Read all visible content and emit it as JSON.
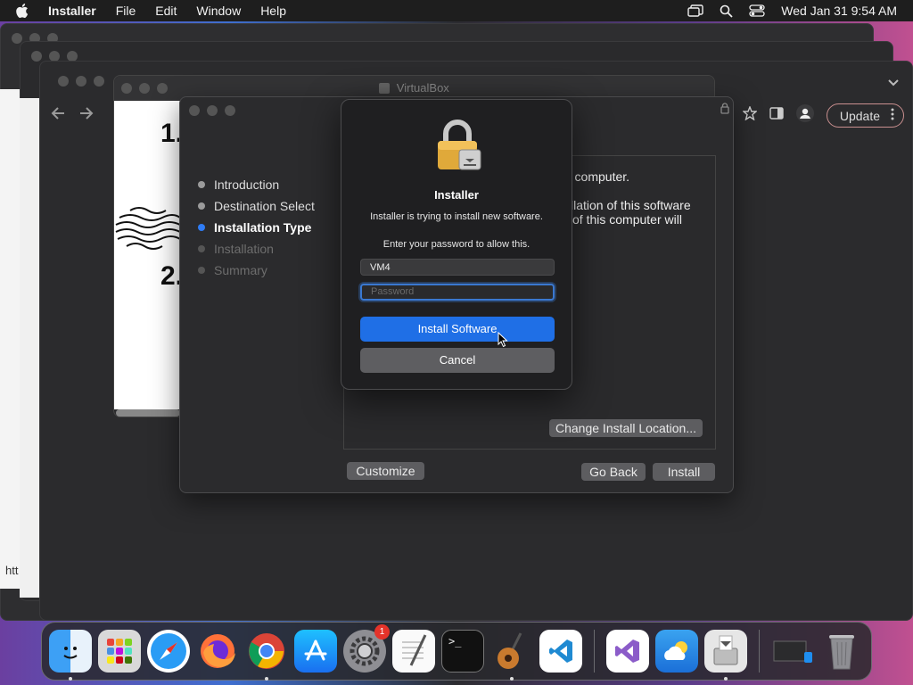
{
  "menubar": {
    "app_name": "Installer",
    "items": [
      "File",
      "Edit",
      "Window",
      "Help"
    ],
    "datetime": "Wed Jan 31  9:54 AM"
  },
  "browser": {
    "update_label": "Update",
    "url_fragment": "htt"
  },
  "virtualbox": {
    "title": "VirtualBox",
    "step1": "1.",
    "step2": "2."
  },
  "installer": {
    "steps": [
      {
        "label": "Introduction",
        "state": "done"
      },
      {
        "label": "Destination Select",
        "state": "done"
      },
      {
        "label": "Installation Type",
        "state": "active"
      },
      {
        "label": "Installation",
        "state": "pending"
      },
      {
        "label": "Summary",
        "state": "pending"
      }
    ],
    "panel_line1": "r computer.",
    "panel_line2": "llation of this software",
    "panel_line3": "of this computer will",
    "change_location_label": "Change Install Location...",
    "customize_label": "Customize",
    "go_back_label": "Go Back",
    "install_label": "Install"
  },
  "auth_dialog": {
    "title": "Installer",
    "message": "Installer is trying to install new software.",
    "prompt": "Enter your password to allow this.",
    "username_value": "VM4",
    "password_placeholder": "Password",
    "primary_label": "Install Software",
    "cancel_label": "Cancel"
  },
  "dock": {
    "apps": [
      {
        "name": "Finder",
        "icon": "finder-icon",
        "color": "#1e8ef0",
        "running": true
      },
      {
        "name": "Launchpad",
        "icon": "launchpad-icon",
        "color": "#d9d9d9",
        "running": false
      },
      {
        "name": "Safari",
        "icon": "safari-icon",
        "color": "#2a9cf5",
        "running": false
      },
      {
        "name": "Firefox",
        "icon": "firefox-icon",
        "color": "#ff7139",
        "running": false
      },
      {
        "name": "Chrome",
        "icon": "chrome-icon",
        "color": "#ffffff",
        "running": true
      },
      {
        "name": "App Store",
        "icon": "app-store-icon",
        "color": "#1f8cf5",
        "running": false
      },
      {
        "name": "System Settings",
        "icon": "system-settings-icon",
        "color": "#8e8e93",
        "running": false,
        "badge": "1"
      },
      {
        "name": "TextEdit",
        "icon": "textedit-icon",
        "color": "#f2f2f2",
        "running": false
      },
      {
        "name": "Terminal",
        "icon": "terminal-icon",
        "color": "#111111",
        "running": false
      },
      {
        "name": "GarageBand",
        "icon": "garageband-icon",
        "color": "#c97a2e",
        "running": true
      },
      {
        "name": "VS Code",
        "icon": "vscode-icon",
        "color": "#ffffff",
        "running": false
      },
      {
        "name": "Visual Studio",
        "icon": "visual-studio-icon",
        "color": "#ffffff",
        "running": false
      },
      {
        "name": "Weather",
        "icon": "weather-icon",
        "color": "#2a87e8",
        "running": false
      },
      {
        "name": "Installer",
        "icon": "installer-icon",
        "color": "#dcdcdc",
        "running": true
      }
    ],
    "extras": [
      {
        "name": "Downloads",
        "icon": "downloads-stack-icon"
      },
      {
        "name": "Trash",
        "icon": "trash-icon"
      }
    ]
  }
}
